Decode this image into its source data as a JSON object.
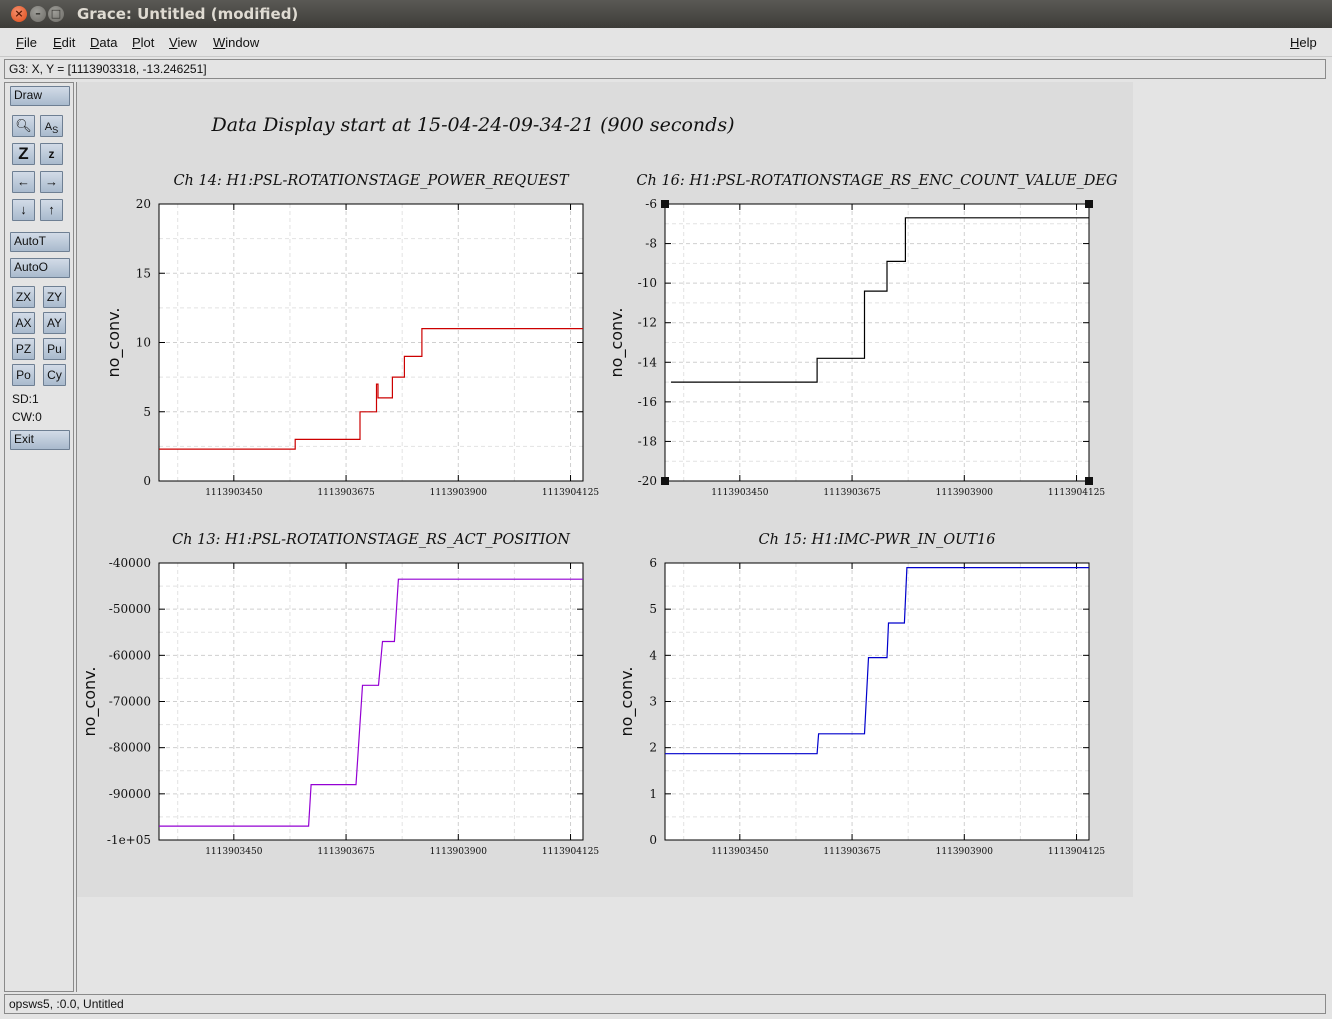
{
  "window": {
    "title": "Grace: Untitled (modified)"
  },
  "menubar": {
    "items": [
      "File",
      "Edit",
      "Data",
      "Plot",
      "View",
      "Window"
    ],
    "help": "Help"
  },
  "locator": {
    "text": "G3: X, Y = [1113903318, -13.246251]"
  },
  "toolbar": {
    "draw": "Draw",
    "autoT": "AutoT",
    "autoO": "AutoO",
    "zx": "ZX",
    "zy": "ZY",
    "ax": "AX",
    "ay": "AY",
    "pz": "PZ",
    "pu": "Pu",
    "po": "Po",
    "cy": "Cy",
    "sd": "SD:1",
    "cw": "CW:0",
    "exit": "Exit",
    "icons": [
      "zoom-icon",
      "autoscale-icon",
      "zoom-in-icon",
      "zoom-out-icon",
      "scroll-left-icon",
      "scroll-right-icon",
      "scroll-down-icon",
      "scroll-up-icon"
    ]
  },
  "status": {
    "text": "opsws5, :0.0, Untitled"
  },
  "canvas": {
    "title": "Data Display start at 15-04-24-09-34-21 (900 seconds)"
  },
  "chart_data": [
    {
      "type": "line",
      "title": "Ch 14: H1:PSL-ROTATIONSTAGE_POWER_REQUEST",
      "ylabel": "no_conv.",
      "xlim": [
        1113903300,
        1113904150
      ],
      "ylim": [
        0,
        20
      ],
      "yticks": [
        "0",
        "5",
        "10",
        "15",
        "20"
      ],
      "xticks": [
        "1113903450",
        "1113903675",
        "1113903900",
        "1113904125"
      ],
      "xtick_values": [
        1113903450,
        1113903675,
        1113903900,
        1113904125
      ],
      "ytick_values": [
        0,
        5,
        10,
        15,
        20
      ],
      "color": "#cc0000",
      "x": [
        1113903300,
        1113903573,
        1113903573,
        1113903703,
        1113903703,
        1113903736,
        1113903736,
        1113903739,
        1113903739,
        1113903768,
        1113903768,
        1113903792,
        1113903792,
        1113903827,
        1113903827,
        1113904150
      ],
      "y": [
        2.3,
        2.3,
        3,
        3,
        5,
        5,
        7,
        7,
        6,
        6,
        7.5,
        7.5,
        9,
        9,
        11,
        11
      ]
    },
    {
      "type": "line",
      "title": "Ch 16: H1:PSL-ROTATIONSTAGE_RS_ENC_COUNT_VALUE_DEG",
      "ylabel": "no_conv.",
      "xlim": [
        1113903300,
        1113904150
      ],
      "ylim": [
        -20,
        -6
      ],
      "yticks": [
        "-20",
        "-18",
        "-16",
        "-14",
        "-12",
        "-10",
        "-8",
        "-6"
      ],
      "xticks": [
        "1113903450",
        "1113903675",
        "1113903900",
        "1113904125"
      ],
      "xtick_values": [
        1113903450,
        1113903675,
        1113903900,
        1113904125
      ],
      "ytick_values": [
        -20,
        -18,
        -16,
        -14,
        -12,
        -10,
        -8,
        -6
      ],
      "color": "#000000",
      "x": [
        1113903312,
        1113903605,
        1113903605,
        1113903700,
        1113903700,
        1113903708,
        1113903708,
        1113903745,
        1113903745,
        1113903776,
        1113903776,
        1113903782,
        1113903782,
        1113903812,
        1113903812,
        1113904150
      ],
      "y": [
        -15,
        -15,
        -13.8,
        -13.8,
        -10.4,
        -10.4,
        -10.4,
        -10.4,
        -8.9,
        -8.9,
        -8.9,
        -8.9,
        -6.7,
        -6.7,
        -6.7,
        -6.7
      ]
    },
    {
      "type": "line",
      "title": "Ch 13: H1:PSL-ROTATIONSTAGE_RS_ACT_POSITION",
      "ylabel": "no_conv.",
      "xlim": [
        1113903300,
        1113904150
      ],
      "ylim": [
        -100000,
        -40000
      ],
      "yticks": [
        "-1e+05",
        "-90000",
        "-80000",
        "-70000",
        "-60000",
        "-50000",
        "-40000"
      ],
      "xticks": [
        "1113903450",
        "1113903675",
        "1113903900",
        "1113904125"
      ],
      "xtick_values": [
        1113903450,
        1113903675,
        1113903900,
        1113904125
      ],
      "ytick_values": [
        -100000,
        -90000,
        -80000,
        -70000,
        -60000,
        -50000,
        -40000
      ],
      "color": "#9400d3",
      "x": [
        1113903300,
        1113903600,
        1113903605,
        1113903695,
        1113903708,
        1113903740,
        1113903748,
        1113903772,
        1113903780,
        1113904150
      ],
      "y": [
        -97000,
        -97000,
        -88000,
        -88000,
        -66500,
        -66500,
        -57000,
        -57000,
        -43500,
        -43500
      ]
    },
    {
      "type": "line",
      "title": "Ch 15: H1:IMC-PWR_IN_OUT16",
      "ylabel": "no_conv.",
      "xlim": [
        1113903300,
        1113904150
      ],
      "ylim": [
        0,
        6
      ],
      "yticks": [
        "0",
        "1",
        "2",
        "3",
        "4",
        "5",
        "6"
      ],
      "xticks": [
        "1113903450",
        "1113903675",
        "1113903900",
        "1113904125"
      ],
      "xtick_values": [
        1113903450,
        1113903675,
        1113903900,
        1113904125
      ],
      "ytick_values": [
        0,
        1,
        2,
        3,
        4,
        5,
        6
      ],
      "color": "#0000cc",
      "x": [
        1113903300,
        1113903605,
        1113903608,
        1113903700,
        1113903708,
        1113903745,
        1113903748,
        1113903780,
        1113903785,
        1113904150
      ],
      "y": [
        1.87,
        1.87,
        2.3,
        2.3,
        3.95,
        3.95,
        4.7,
        4.7,
        5.9,
        5.9
      ]
    }
  ]
}
